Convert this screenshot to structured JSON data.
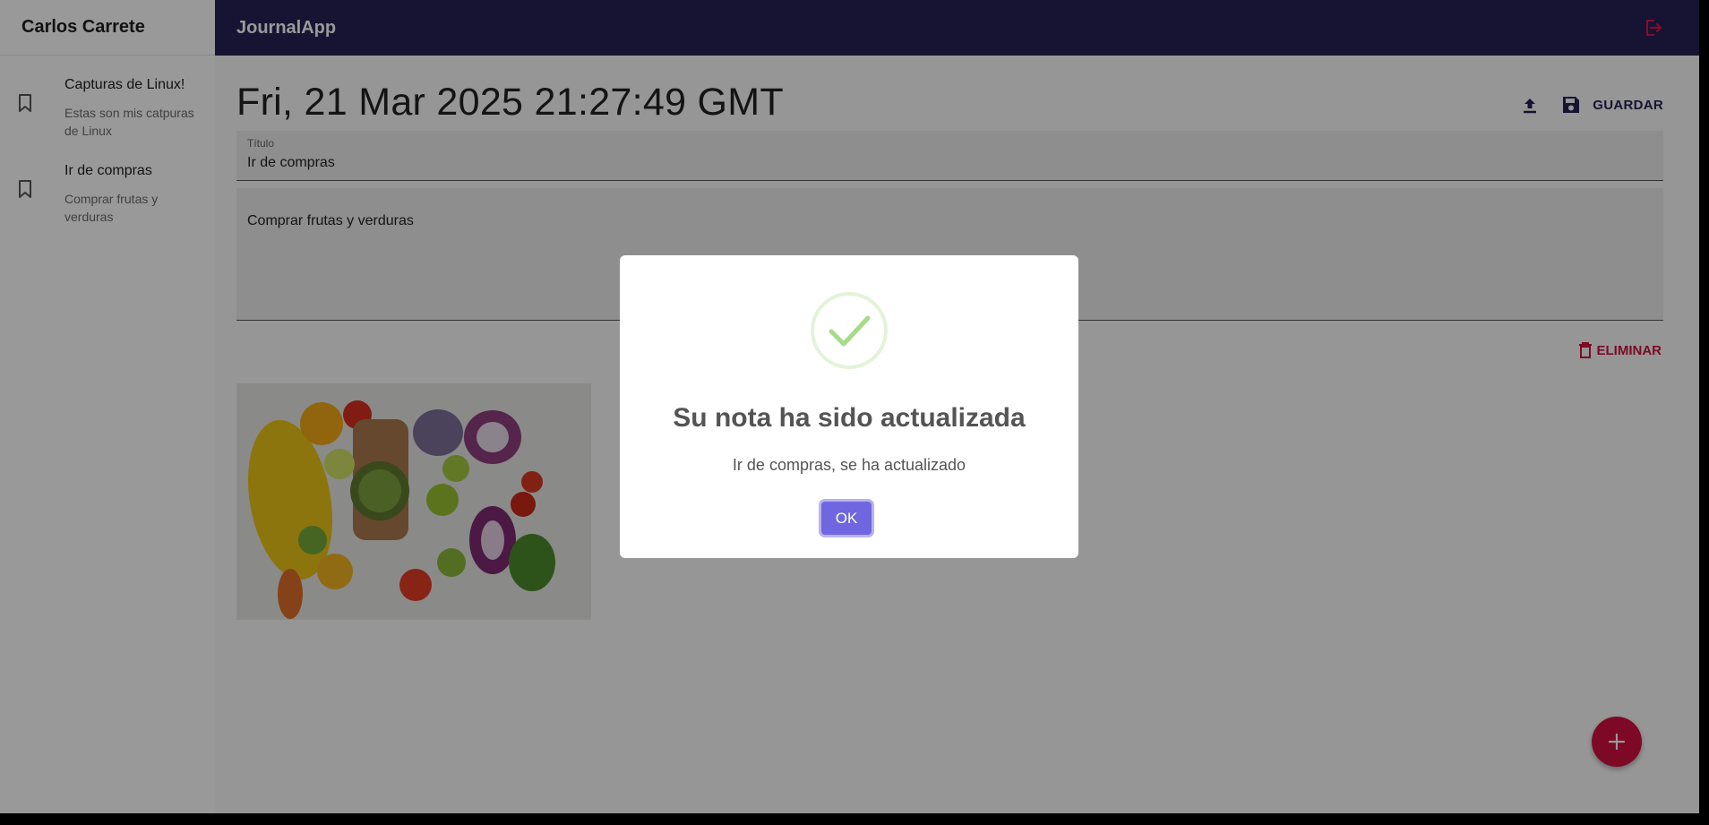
{
  "sidebar": {
    "user_name": "Carlos Carrete",
    "notes": [
      {
        "title": "Capturas de Linux!",
        "body": "Estas son mis catpuras de Linux",
        "icon": "bookmark-icon"
      },
      {
        "title": "Ir de compras",
        "body": "Comprar frutas y verduras",
        "icon": "bookmark-icon"
      }
    ]
  },
  "topbar": {
    "app_title": "JournalApp",
    "logout_icon": "logout-icon"
  },
  "note": {
    "date": "Fri, 21 Mar 2025 21:27:49 GMT",
    "save_label": "GUARDAR",
    "title_label": "Título",
    "title_value": "Ir de compras",
    "body_value": "Comprar frutas y verduras",
    "delete_label": "ELIMINAR"
  },
  "dialog": {
    "title": "Su nota ha sido actualizada",
    "text": "Ir de compras, se ha actualizado",
    "ok_label": "OK"
  },
  "colors": {
    "topbar": "#262254",
    "accent_red": "#d01041",
    "confirm_button": "#7066e0",
    "success_green": "#a5dc86"
  }
}
